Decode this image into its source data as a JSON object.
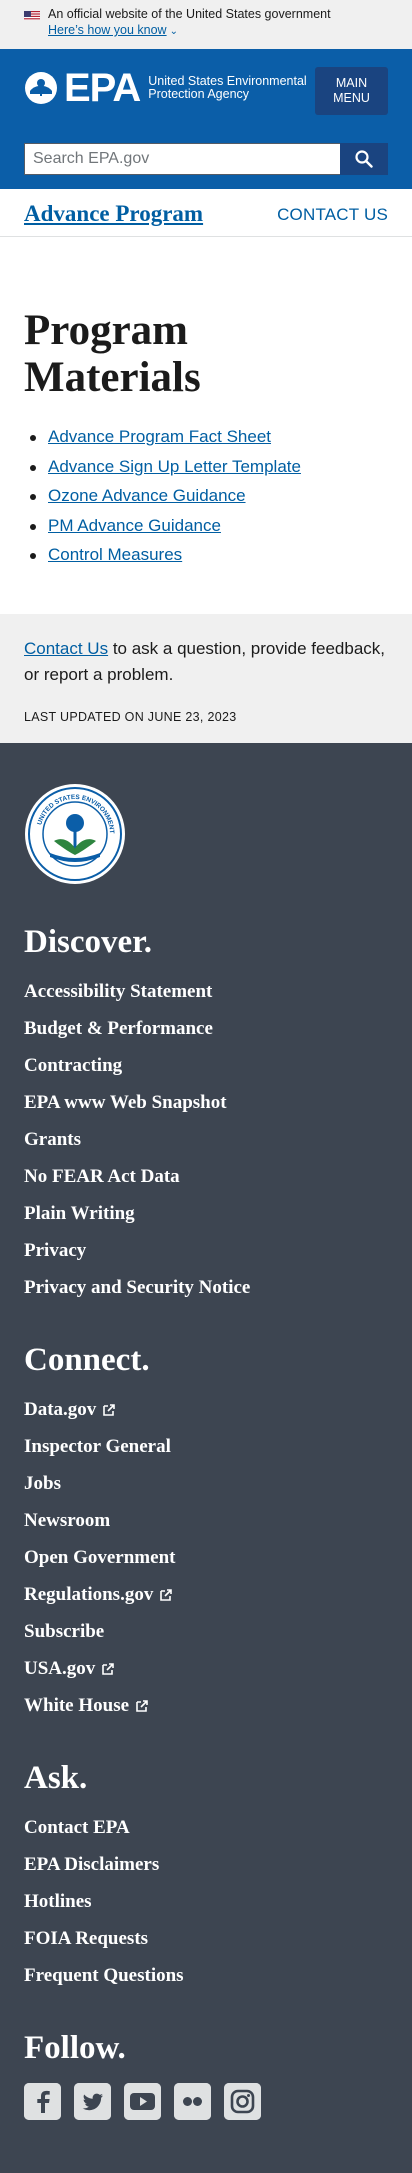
{
  "gov_banner": {
    "official_text": "An official website of the United States government",
    "how_you_know": "Here’s how you know"
  },
  "header": {
    "logo_text": "EPA",
    "logo_subtitle": "United States Environmental Protection Agency",
    "menu_label_1": "MAIN",
    "menu_label_2": "MENU"
  },
  "search": {
    "placeholder": "Search EPA.gov"
  },
  "program": {
    "title": "Advance Program",
    "contact": "CONTACT US"
  },
  "page": {
    "title_line1": "Program",
    "title_line2": "Materials",
    "materials": [
      {
        "label": "Advance Program Fact Sheet"
      },
      {
        "label": "Advance Sign Up Letter Template"
      },
      {
        "label": "Ozone Advance Guidance"
      },
      {
        "label": "PM Advance Guidance"
      },
      {
        "label": "Control Measures"
      }
    ]
  },
  "contact_area": {
    "link": "Contact Us",
    "text": " to ask a question, provide feedback, or report a problem.",
    "last_updated": "LAST UPDATED ON JUNE 23, 2023"
  },
  "footer": {
    "seal_text": "UNITED STATES ENVIRONMENTAL PROTECTION AGENCY",
    "discover": {
      "heading": "Discover.",
      "items": [
        "Accessibility Statement",
        "Budget & Performance",
        "Contracting",
        "EPA www Web Snapshot",
        "Grants",
        "No FEAR Act Data",
        "Plain Writing",
        "Privacy",
        "Privacy and Security Notice"
      ]
    },
    "connect": {
      "heading": "Connect.",
      "items": [
        "Data.gov",
        "Inspector General",
        "Jobs",
        "Newsroom",
        "Open Government",
        "Regulations.gov",
        "Subscribe",
        "USA.gov",
        "White House"
      ]
    },
    "ask": {
      "heading": "Ask.",
      "items": [
        "Contact EPA",
        "EPA Disclaimers",
        "Hotlines",
        "FOIA Requests",
        "Frequent Questions"
      ]
    },
    "follow": {
      "heading": "Follow.",
      "icons": [
        "facebook-icon",
        "twitter-icon",
        "youtube-icon",
        "flickr-icon",
        "instagram-icon"
      ]
    }
  },
  "colors": {
    "header_blue": "#0b5ea8",
    "button_navy": "#1a4480",
    "link_blue": "#005ea2",
    "footer_bg": "#3d4551"
  }
}
